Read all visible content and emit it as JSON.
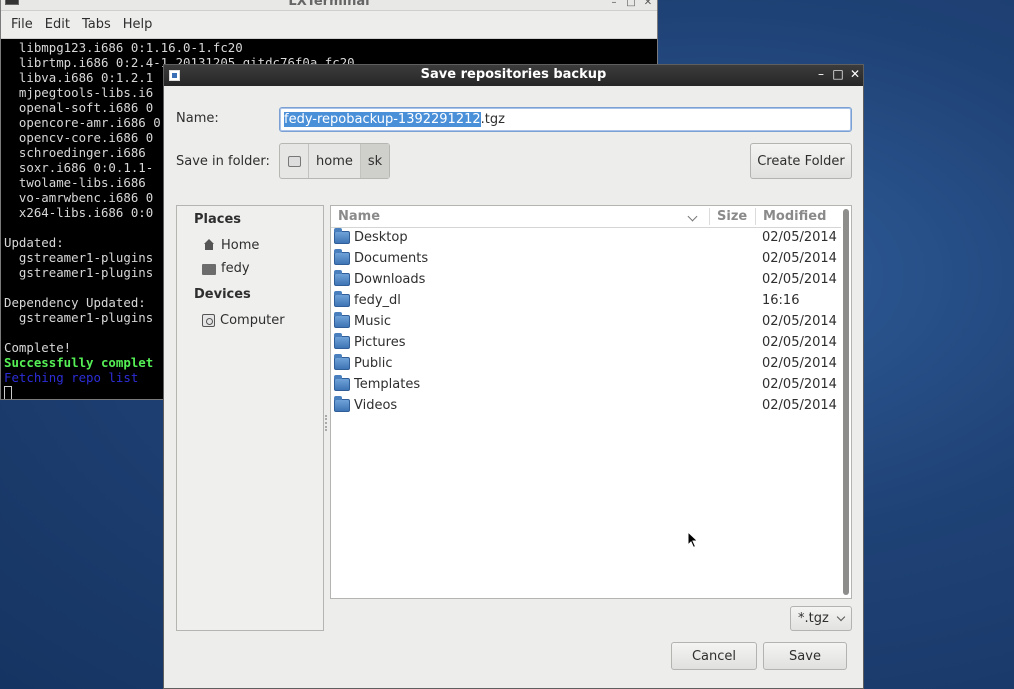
{
  "terminal": {
    "title": "LXTerminal",
    "menu": [
      "File",
      "Edit",
      "Tabs",
      "Help"
    ],
    "lines": [
      "  libmpg123.i686 0:1.16.0-1.fc20",
      "  librtmp.i686 0:2.4-1.20131205.gitdc76f0a.fc20",
      "  libva.i686 0:1.2.1",
      "  mjpegtools-libs.i6",
      "  openal-soft.i686 0",
      "  opencore-amr.i686 0",
      "  opencv-core.i686 0",
      "  schroedinger.i686",
      "  soxr.i686 0:0.1.1-",
      "  twolame-libs.i686",
      "  vo-amrwbenc.i686 0",
      "  x264-libs.i686 0:0",
      "",
      "Updated:",
      "  gstreamer1-plugins",
      "  gstreamer1-plugins",
      "",
      "Dependency Updated:",
      "  gstreamer1-plugins",
      "",
      "Complete!"
    ],
    "success_line": "Successfully complet",
    "fetch_line": "Fetching repo list"
  },
  "dialog": {
    "title": "Save repositories backup",
    "name_label": "Name:",
    "name_selected": "fedy-repobackup-1392291212",
    "name_rest": ".tgz",
    "folder_label": "Save in folder:",
    "path": [
      "home",
      "sk"
    ],
    "create_folder": "Create Folder",
    "places_heading": "Places",
    "places": [
      "Home",
      "fedy"
    ],
    "devices_heading": "Devices",
    "devices": [
      "Computer"
    ],
    "columns": {
      "name": "Name",
      "size": "Size",
      "modified": "Modified"
    },
    "files": [
      {
        "name": "Desktop",
        "modified": "02/05/2014"
      },
      {
        "name": "Documents",
        "modified": "02/05/2014"
      },
      {
        "name": "Downloads",
        "modified": "02/05/2014"
      },
      {
        "name": "fedy_dl",
        "modified": "16:16"
      },
      {
        "name": "Music",
        "modified": "02/05/2014"
      },
      {
        "name": "Pictures",
        "modified": "02/05/2014"
      },
      {
        "name": "Public",
        "modified": "02/05/2014"
      },
      {
        "name": "Templates",
        "modified": "02/05/2014"
      },
      {
        "name": "Videos",
        "modified": "02/05/2014"
      }
    ],
    "filter": "*.tgz",
    "cancel": "Cancel",
    "save": "Save"
  }
}
